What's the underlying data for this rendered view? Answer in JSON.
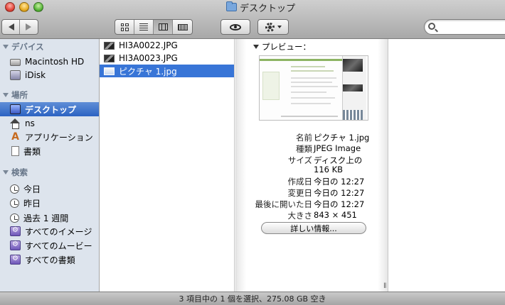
{
  "window": {
    "title": "デスクトップ"
  },
  "toolbar": {
    "view_modes": [
      "icon",
      "list",
      "column",
      "coverflow"
    ],
    "active_view": "column",
    "search_placeholder": ""
  },
  "sidebar": {
    "sections": [
      {
        "header": "デバイス",
        "items": [
          {
            "label": "Macintosh HD",
            "icon": "hard-disk-icon"
          },
          {
            "label": "iDisk",
            "icon": "idisk-icon"
          }
        ]
      },
      {
        "header": "場所",
        "items": [
          {
            "label": "デスクトップ",
            "icon": "desktop-icon",
            "selected": true
          },
          {
            "label": "ns",
            "icon": "home-icon"
          },
          {
            "label": "アプリケーション",
            "icon": "applications-icon"
          },
          {
            "label": "書類",
            "icon": "documents-icon"
          }
        ]
      },
      {
        "header": "検索",
        "items": [
          {
            "label": "今日",
            "icon": "clock-icon"
          },
          {
            "label": "昨日",
            "icon": "clock-icon"
          },
          {
            "label": "過去 1 週間",
            "icon": "clock-icon"
          },
          {
            "label": "すべてのイメージ",
            "icon": "smart-folder-icon"
          },
          {
            "label": "すべてのムービー",
            "icon": "smart-folder-icon"
          },
          {
            "label": "すべての書類",
            "icon": "smart-folder-icon"
          }
        ]
      }
    ]
  },
  "files": [
    {
      "name": "HI3A0022.JPG",
      "selected": false
    },
    {
      "name": "HI3A0023.JPG",
      "selected": false
    },
    {
      "name": "ピクチャ 1.jpg",
      "selected": true
    }
  ],
  "preview": {
    "header": "プレビュー：",
    "metadata": [
      {
        "key": "名前",
        "value": "ピクチャ 1.jpg"
      },
      {
        "key": "種類",
        "value": "JPEG Image"
      },
      {
        "key": "サイズ",
        "value": "ディスク上の"
      },
      {
        "key": "",
        "value": "116 KB"
      },
      {
        "key": "作成日",
        "value": "今日の 12:27"
      },
      {
        "key": "変更日",
        "value": "今日の 12:27"
      },
      {
        "key": "最後に開いた日",
        "value": "今日の 12:27"
      },
      {
        "key": "大きさ",
        "value": "843 × 451"
      }
    ],
    "more_info_button": "詳しい情報..."
  },
  "status": {
    "text": "3 項目中の 1 個を選択、275.08 GB 空き"
  }
}
